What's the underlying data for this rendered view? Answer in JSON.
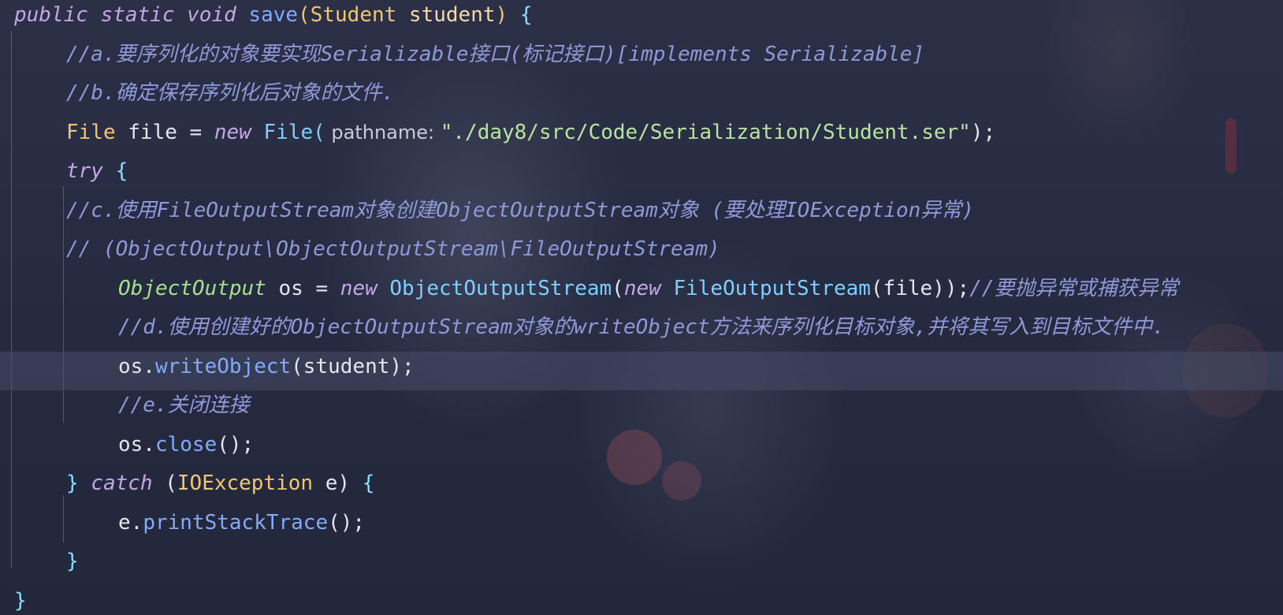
{
  "editor": {
    "lines": [
      {
        "indent": 0,
        "tokens": [
          {
            "t": "public static void ",
            "c": "kw"
          },
          {
            "t": "save",
            "c": "fn"
          },
          {
            "t": "(",
            "c": "type"
          },
          {
            "t": "Student",
            "c": "type"
          },
          {
            "t": " student",
            "c": "param"
          },
          {
            "t": ") ",
            "c": "type"
          },
          {
            "t": "{",
            "c": "brace"
          }
        ]
      },
      {
        "indent": 1,
        "tokens": [
          {
            "t": "//a.要序列化的对象要实现Serializable接口(标记接口)[implements Serializable]",
            "c": "cmt"
          }
        ]
      },
      {
        "indent": 1,
        "tokens": [
          {
            "t": "//b.确定保存序列化后对象的文件.",
            "c": "cmt"
          }
        ]
      },
      {
        "indent": 1,
        "tokens": [
          {
            "t": "File",
            "c": "type"
          },
          {
            "t": " file ",
            "c": "var"
          },
          {
            "t": "= ",
            "c": "punc"
          },
          {
            "t": "new ",
            "c": "kw"
          },
          {
            "t": "File(",
            "c": "cls"
          },
          {
            "t": " pathname: ",
            "c": "hint"
          },
          {
            "t": "\"./day8/src/Code/Serialization/Student.ser\"",
            "c": "str"
          },
          {
            "t": ");",
            "c": "punc"
          }
        ]
      },
      {
        "indent": 1,
        "tokens": [
          {
            "t": "try ",
            "c": "kw"
          },
          {
            "t": "{",
            "c": "brace"
          }
        ]
      },
      {
        "indent": 1,
        "tokens": [
          {
            "t": "//c.使用FileOutputStream对象创建ObjectOutputStream对象 (要处理IOException异常)",
            "c": "cmt"
          }
        ]
      },
      {
        "indent": 1,
        "tokens": [
          {
            "t": "// (ObjectOutput\\ObjectOutputStream\\FileOutputStream)",
            "c": "cmt"
          }
        ]
      },
      {
        "indent": 2,
        "tokens": [
          {
            "t": "ObjectOutput",
            "c": "iface"
          },
          {
            "t": " os ",
            "c": "var"
          },
          {
            "t": "= ",
            "c": "punc"
          },
          {
            "t": "new ",
            "c": "kw"
          },
          {
            "t": "ObjectOutputStream",
            "c": "cls"
          },
          {
            "t": "(",
            "c": "punc"
          },
          {
            "t": "new ",
            "c": "kw"
          },
          {
            "t": "FileOutputStream",
            "c": "cls"
          },
          {
            "t": "(file));",
            "c": "punc"
          },
          {
            "t": "//要抛异常或捕获异常",
            "c": "cmt"
          }
        ]
      },
      {
        "indent": 2,
        "tokens": [
          {
            "t": "//d.使用创建好的ObjectOutputStream对象的writeObject方法来序列化目标对象,并将其写入到目标文件中.",
            "c": "cmt"
          }
        ]
      },
      {
        "indent": 2,
        "current": true,
        "tokens": [
          {
            "t": "os.",
            "c": "var"
          },
          {
            "t": "writeObject",
            "c": "fn"
          },
          {
            "t": "(student);",
            "c": "punc"
          }
        ]
      },
      {
        "indent": 2,
        "tokens": [
          {
            "t": "//e.关闭连接",
            "c": "cmt"
          }
        ]
      },
      {
        "indent": 2,
        "tokens": [
          {
            "t": "os.",
            "c": "var"
          },
          {
            "t": "close",
            "c": "fn"
          },
          {
            "t": "();",
            "c": "punc"
          }
        ]
      },
      {
        "indent": 1,
        "tokens": [
          {
            "t": "} ",
            "c": "brace"
          },
          {
            "t": "catch ",
            "c": "kw"
          },
          {
            "t": "(",
            "c": "punc"
          },
          {
            "t": "IOException",
            "c": "type"
          },
          {
            "t": " e) ",
            "c": "var"
          },
          {
            "t": "{",
            "c": "brace"
          }
        ]
      },
      {
        "indent": 2,
        "tokens": [
          {
            "t": "e.",
            "c": "var"
          },
          {
            "t": "printStackTrace",
            "c": "fn"
          },
          {
            "t": "();",
            "c": "punc"
          }
        ]
      },
      {
        "indent": 1,
        "tokens": [
          {
            "t": "}",
            "c": "brace"
          }
        ]
      },
      {
        "indent": 0,
        "tokens": [
          {
            "t": "}",
            "c": "brace"
          }
        ]
      }
    ]
  }
}
